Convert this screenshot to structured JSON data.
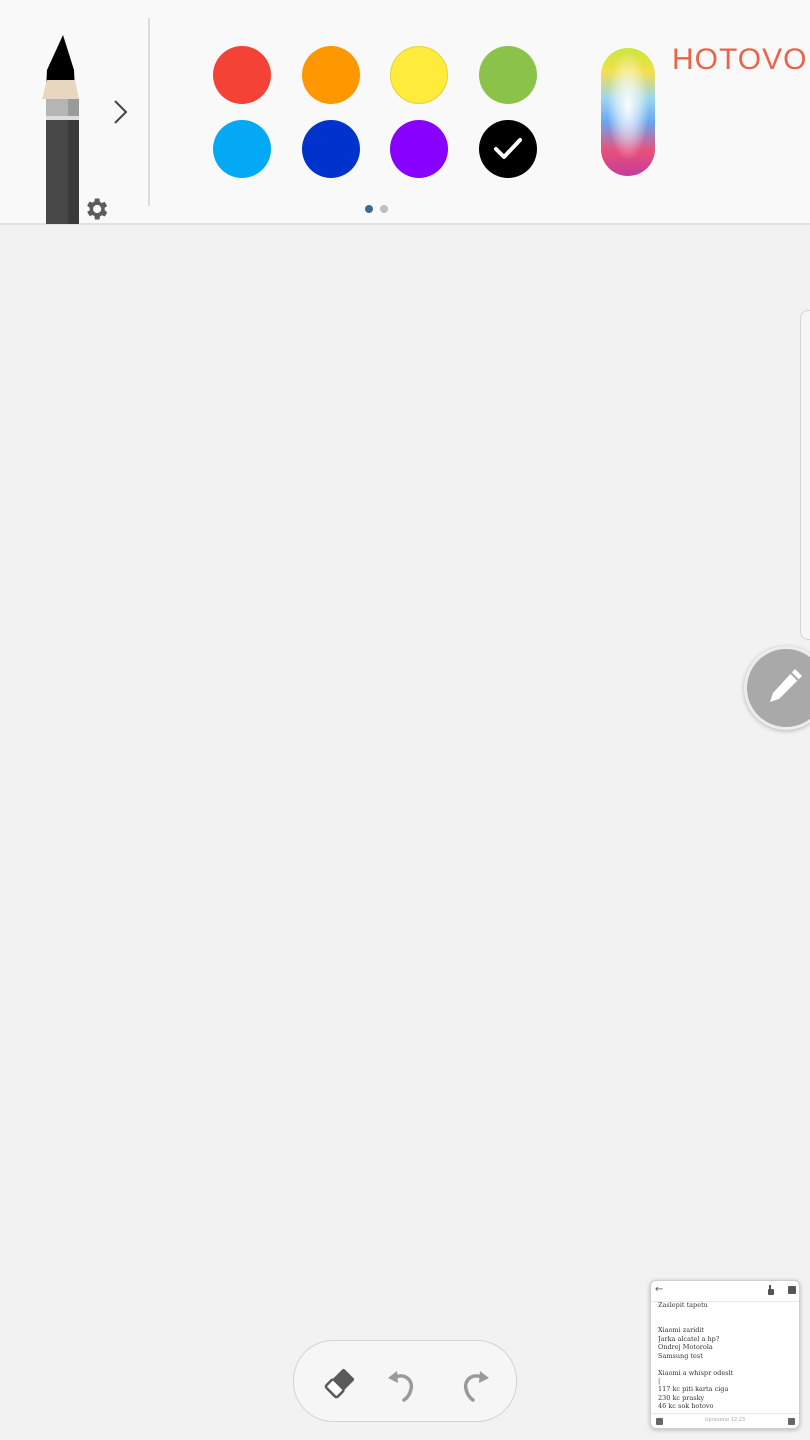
{
  "toolbar": {
    "done_label": "HOTOVO",
    "pen_color": "#000000",
    "swatches": [
      {
        "name": "red",
        "color": "#f44336",
        "selected": false
      },
      {
        "name": "orange",
        "color": "#ff9800",
        "selected": false
      },
      {
        "name": "yellow",
        "color": "#ffeb3b",
        "selected": false
      },
      {
        "name": "green",
        "color": "#8bc34a",
        "selected": false
      },
      {
        "name": "light-blue",
        "color": "#03a9f4",
        "selected": false
      },
      {
        "name": "blue",
        "color": "#0033cc",
        "selected": false
      },
      {
        "name": "purple",
        "color": "#8800ff",
        "selected": false
      },
      {
        "name": "black",
        "color": "#000000",
        "selected": true
      }
    ],
    "pages": {
      "count": 2,
      "current": 1
    }
  },
  "icons": {
    "settings": "gear-icon",
    "expand": "chevron-right-icon",
    "floating_pen": "pen-icon",
    "eraser": "eraser-icon",
    "undo": "undo-icon",
    "redo": "redo-icon"
  },
  "note_preview": {
    "lines": [
      "Zaslepit tapetu",
      "",
      "",
      "Xiaomi zaridit",
      "Jarka alcatel a hp?",
      "Ondrej Motorola",
      "Samsung test",
      "",
      "Xiaomi a whispr odeslt",
      "|",
      "117 kc piti karta ciga",
      "230 kc prasky",
      "46 kc sok hotovo"
    ],
    "status": "Upraveno 12:23"
  },
  "colors": {
    "accent": "#e9654a",
    "canvas": "#f2f2f2",
    "toolbar": "#f9f9f9"
  }
}
